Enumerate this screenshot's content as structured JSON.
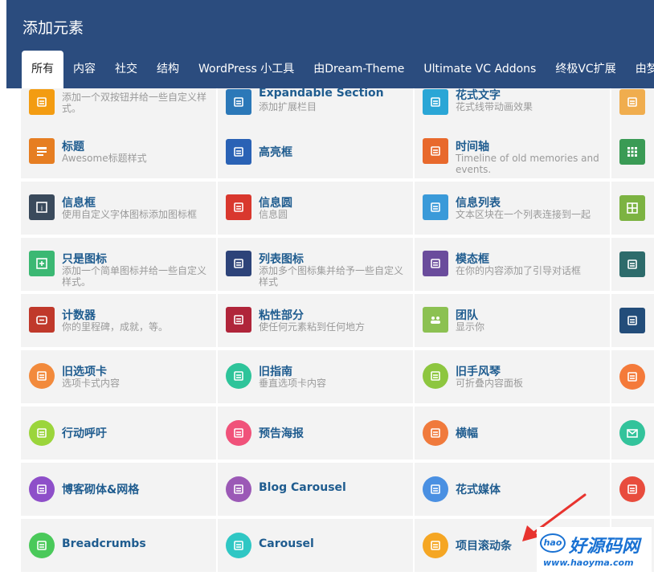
{
  "dialog": {
    "title": "添加元素"
  },
  "tabs": [
    {
      "label": "所有",
      "active": true
    },
    {
      "label": "内容"
    },
    {
      "label": "社交"
    },
    {
      "label": "结构"
    },
    {
      "label": "WordPress 小工具"
    },
    {
      "label": "由Dream-Theme"
    },
    {
      "label": "Ultimate VC Addons"
    },
    {
      "label": "终极VC扩展"
    },
    {
      "label": "由梦"
    }
  ],
  "rows": [
    [
      {
        "name": "",
        "desc": "添加一个双按钮并给一些自定义样式。",
        "icon": "dual-button-icon",
        "color": "#f39c12",
        "shape": "sq"
      },
      {
        "name": "Expandable Section",
        "desc": "添加扩展栏目",
        "icon": "expand-icon",
        "color": "#2b78b8",
        "shape": "sq"
      },
      {
        "name": "花式文字",
        "desc": "花式线带动画效果",
        "icon": "fancy-text-icon",
        "color": "#2aa6d6",
        "shape": "sq"
      },
      {
        "name": "",
        "desc": "",
        "icon": "swap-icon",
        "color": "#f0ad4e",
        "shape": "sq"
      }
    ],
    [
      {
        "name": "标题",
        "desc": "Awesome标题样式",
        "icon": "heading-icon",
        "color": "#e67e22",
        "shape": "sq"
      },
      {
        "name": "高亮框",
        "desc": "",
        "icon": "highlight-box-icon",
        "color": "#2a62b5",
        "shape": "sq"
      },
      {
        "name": "时间轴",
        "desc": "Timeline of old memories and events.",
        "icon": "timeline-icon",
        "color": "#e8692c",
        "shape": "sq"
      },
      {
        "name": "",
        "desc": "",
        "icon": "grid-icon",
        "color": "#3a9b55",
        "shape": "sq"
      }
    ],
    [
      {
        "name": "信息框",
        "desc": "使用自定义字体图标添加图标框",
        "icon": "info-box-icon",
        "color": "#3a4a5c",
        "shape": "sq"
      },
      {
        "name": "信息圆",
        "desc": "信息圆",
        "icon": "info-circle-icon",
        "color": "#d9382e",
        "shape": "sq"
      },
      {
        "name": "信息列表",
        "desc": "文本区块在一个列表连接到一起",
        "icon": "info-list-icon",
        "color": "#3a9ad9",
        "shape": "sq"
      },
      {
        "name": "",
        "desc": "",
        "icon": "table-icon",
        "color": "#7cb342",
        "shape": "sq"
      }
    ],
    [
      {
        "name": "只是图标",
        "desc": "添加一个简单图标并给一些自定义样式。",
        "icon": "just-icon-icon",
        "color": "#3bb873",
        "shape": "sq"
      },
      {
        "name": "列表图标",
        "desc": "添加多个图标集并给予一些自定义样式",
        "icon": "list-icon-icon",
        "color": "#2d4379",
        "shape": "sq"
      },
      {
        "name": "模态框",
        "desc": "在你的内容添加了引导对话框",
        "icon": "modal-icon",
        "color": "#6a4c9c",
        "shape": "sq"
      },
      {
        "name": "",
        "desc": "",
        "icon": "tag-icon",
        "color": "#2d6b6b",
        "shape": "sq"
      }
    ],
    [
      {
        "name": "计数器",
        "desc": "你的里程碑，成就，等。",
        "icon": "counter-icon",
        "color": "#c0392b",
        "shape": "sq"
      },
      {
        "name": "粘性部分",
        "desc": "使任何元素粘到任何地方",
        "icon": "sticky-icon",
        "color": "#b0253a",
        "shape": "sq"
      },
      {
        "name": "团队",
        "desc": "显示你",
        "icon": "team-icon",
        "color": "#8cc152",
        "shape": "sq"
      },
      {
        "name": "",
        "desc": "",
        "icon": "sparkle-icon",
        "color": "#234d7a",
        "shape": "sq"
      }
    ],
    [
      {
        "name": "旧选项卡",
        "desc": "选项卡式内容",
        "icon": "old-tabs-icon",
        "color": "#f28a3c",
        "shape": "ci"
      },
      {
        "name": "旧指南",
        "desc": "垂直选项卡内容",
        "icon": "old-tour-icon",
        "color": "#2ec49a",
        "shape": "ci"
      },
      {
        "name": "旧手风琴",
        "desc": "可折叠内容面板",
        "icon": "old-accordion-icon",
        "color": "#8dc63f",
        "shape": "ci"
      },
      {
        "name": "",
        "desc": "",
        "icon": "text-separator-icon",
        "color": "#f47a3a",
        "shape": "ci"
      }
    ],
    [
      {
        "name": "行动呼吁",
        "desc": "",
        "icon": "cta-icon",
        "color": "#9bd53b",
        "shape": "ci"
      },
      {
        "name": "预告海报",
        "desc": "",
        "icon": "teaser-icon",
        "color": "#f0527a",
        "shape": "ci"
      },
      {
        "name": "横幅",
        "desc": "",
        "icon": "banner-icon",
        "color": "#f07a3c",
        "shape": "ci"
      },
      {
        "name": "",
        "desc": "",
        "icon": "mail-icon",
        "color": "#33c39b",
        "shape": "ci"
      }
    ],
    [
      {
        "name": "博客砌体&网格",
        "desc": "",
        "icon": "blog-masonry-icon",
        "color": "#8e4fc9",
        "shape": "ci"
      },
      {
        "name": "Blog Carousel",
        "desc": "",
        "icon": "blog-carousel-icon",
        "color": "#9b59b6",
        "shape": "ci"
      },
      {
        "name": "花式媒体",
        "desc": "",
        "icon": "fancy-media-icon",
        "color": "#4a90e2",
        "shape": "ci"
      },
      {
        "name": "",
        "desc": "",
        "icon": "button-icon",
        "color": "#e84c3d",
        "shape": "ci"
      }
    ],
    [
      {
        "name": "Breadcrumbs",
        "desc": "",
        "icon": "breadcrumbs-icon",
        "color": "#4ac95a",
        "shape": "ci"
      },
      {
        "name": "Carousel",
        "desc": "",
        "icon": "carousel-icon",
        "color": "#2fc7c4",
        "shape": "ci"
      },
      {
        "name": "项目滚动条",
        "desc": "",
        "icon": "portfolio-scroller-icon",
        "color": "#f5a623",
        "shape": "ci"
      },
      {
        "name": "",
        "desc": "",
        "icon": "blank-icon",
        "color": "#ffffff",
        "shape": "ci"
      }
    ]
  ],
  "watermark": {
    "hao": "hao",
    "brand": "好源码网",
    "url": "www.haoyma.com"
  },
  "colors": {
    "header": "#2b4c7e",
    "link": "#1f5c8f",
    "cell_bg": "#f3f3f3",
    "arrow": "#e8332e"
  }
}
